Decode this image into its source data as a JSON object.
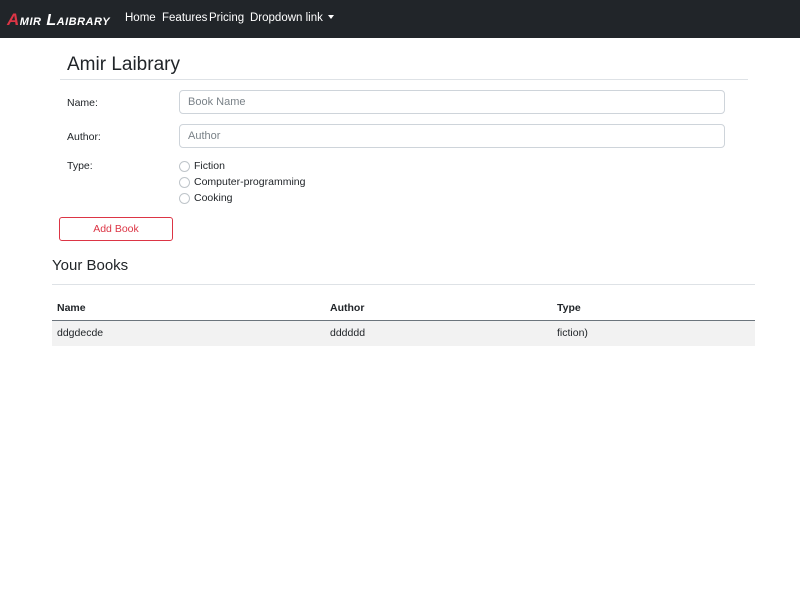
{
  "navbar": {
    "brand_first": "A",
    "brand_rest": "mir Laibrary",
    "links": [
      "Home",
      "Features",
      "Pricing"
    ],
    "dropdown_label": "Dropdown link"
  },
  "header": {
    "title": "Amir Laibrary"
  },
  "form": {
    "name_label": "Name:",
    "name_placeholder": "Book Name",
    "name_value": "",
    "author_label": "Author:",
    "author_placeholder": "Author",
    "author_value": "",
    "type_label": "Type:",
    "type_options": [
      "Fiction",
      "Computer-programming",
      "Cooking"
    ],
    "submit_label": "Add Book"
  },
  "books": {
    "title": "Your Books",
    "columns": [
      "Name",
      "Author",
      "Type"
    ],
    "rows": [
      [
        "ddgdecde",
        "dddddd",
        "fiction)"
      ]
    ]
  },
  "colors": {
    "navbar_bg": "#212529",
    "accent": "#dc3545",
    "row_stripe": "#f2f2f2"
  }
}
